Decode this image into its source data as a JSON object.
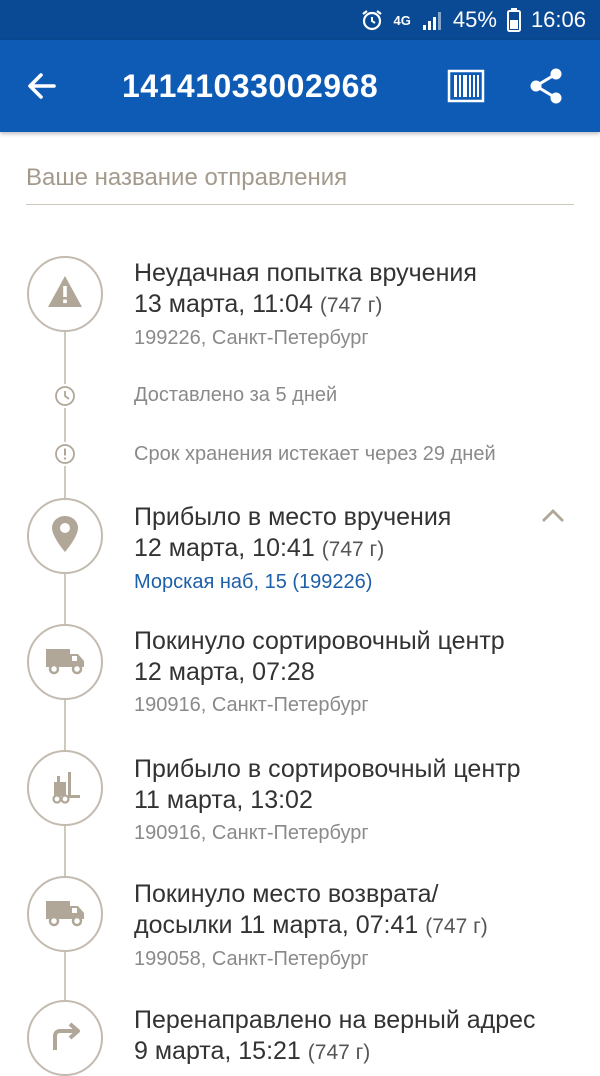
{
  "status_bar": {
    "network": "4G",
    "battery": "45%",
    "time": "16:06"
  },
  "app_bar": {
    "tracking_number": "14141033002968"
  },
  "name_field": {
    "placeholder": "Ваше название отправления",
    "value": ""
  },
  "colors": {
    "primary": "#0e5bb5",
    "status_bar": "#0a4a94",
    "icon_gray": "#b0a799",
    "link": "#1d5fa8"
  },
  "events": [
    {
      "icon": "warning-icon",
      "title": "Неудачная попытка вручения",
      "date": "13 марта, 11:04",
      "weight": "(747 г)",
      "location": "199226, Санкт-Петербург"
    },
    {
      "icon": "location-pin-icon",
      "title": "Прибыло в место вручения",
      "date": "12 марта, 10:41",
      "weight": "(747 г)",
      "location_link": "Морская наб, 15 (199226)"
    },
    {
      "icon": "truck-icon",
      "title": "Покинуло сортировочный центр",
      "date": "12 марта, 07:28",
      "location": "190916, Санкт-Петербург"
    },
    {
      "icon": "forklift-icon",
      "title": "Прибыло в сортировочный центр",
      "date": "11 марта, 13:02",
      "location": "190916, Санкт-Петербург"
    },
    {
      "icon": "truck-icon",
      "title": "Покинуло место возврата/",
      "title_cont": "досылки",
      "date": "11 марта, 07:41",
      "weight": "(747 г)",
      "location": "199058, Санкт-Петербург"
    },
    {
      "icon": "redirect-arrow-icon",
      "title": "Перенаправлено на верный адрес",
      "date": "9 марта, 15:21",
      "weight": "(747 г)"
    }
  ],
  "info": {
    "delivered_in": "Доставлено за 5 дней",
    "storage_expires": "Срок хранения истекает через 29 дней"
  }
}
